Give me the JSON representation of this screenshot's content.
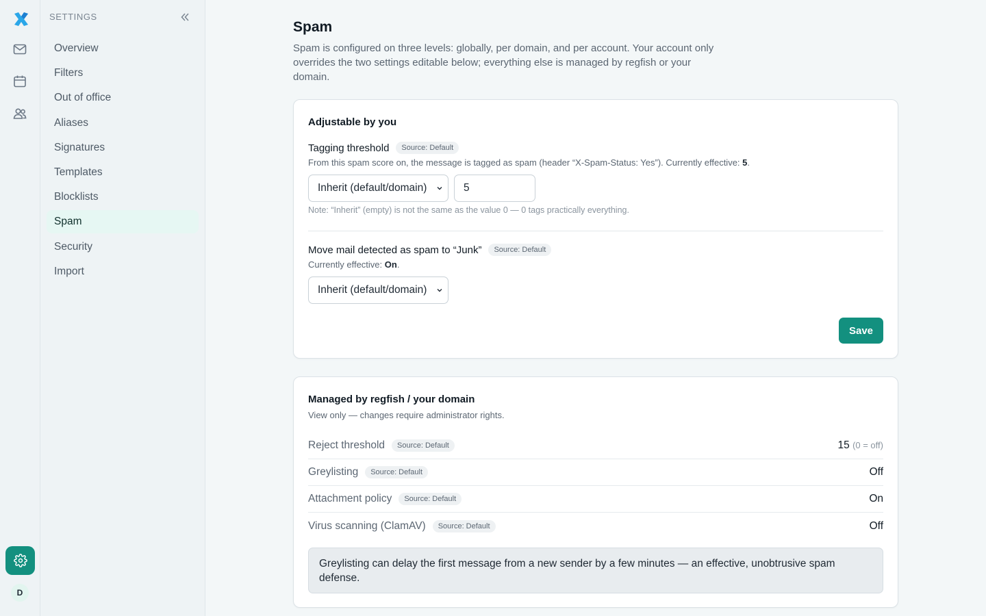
{
  "rail": {
    "icons": [
      "mail-icon",
      "calendar-icon",
      "contacts-icon"
    ],
    "avatar_initial": "D",
    "brand_color": "#13907f"
  },
  "sidebar": {
    "header": "SETTINGS",
    "items": [
      {
        "label": "Overview"
      },
      {
        "label": "Filters"
      },
      {
        "label": "Out of office"
      },
      {
        "label": "Aliases"
      },
      {
        "label": "Signatures"
      },
      {
        "label": "Templates"
      },
      {
        "label": "Blocklists"
      },
      {
        "label": "Spam",
        "active": true
      },
      {
        "label": "Security"
      },
      {
        "label": "Import"
      }
    ]
  },
  "page": {
    "title": "Spam",
    "description": "Spam is configured on three levels: globally, per domain, and per account. Your account only overrides the two settings editable below; everything else is managed by regfish or your domain."
  },
  "adjustable": {
    "title": "Adjustable by you",
    "tagging": {
      "label": "Tagging threshold",
      "source": "Source: Default",
      "help_prefix": "From this spam score on, the message is tagged as spam (header “X-Spam-Status: Yes”). Currently effective: ",
      "effective": "5",
      "help_suffix": ".",
      "select_value": "Inherit (default/domain)",
      "input_value": "5",
      "note": "Note: “Inherit” (empty) is not the same as the value 0 — 0 tags practically everything."
    },
    "junk": {
      "label": "Move mail detected as spam to “Junk”",
      "source": "Source: Default",
      "help_prefix": "Currently effective: ",
      "effective": "On",
      "help_suffix": ".",
      "select_value": "Inherit (default/domain)"
    },
    "save_label": "Save"
  },
  "managed": {
    "title": "Managed by regfish / your domain",
    "subtitle": "View only — changes require administrator rights.",
    "rows": [
      {
        "label": "Reject threshold",
        "source": "Source: Default",
        "value": "15",
        "suffix": "(0 = off)"
      },
      {
        "label": "Greylisting",
        "source": "Source: Default",
        "value": "Off",
        "suffix": ""
      },
      {
        "label": "Attachment policy",
        "source": "Source: Default",
        "value": "On",
        "suffix": ""
      },
      {
        "label": "Virus scanning (ClamAV)",
        "source": "Source: Default",
        "value": "Off",
        "suffix": ""
      }
    ],
    "info": "Greylisting can delay the first message from a new sender by a few minutes — an effective, unobtrusive spam defense."
  }
}
